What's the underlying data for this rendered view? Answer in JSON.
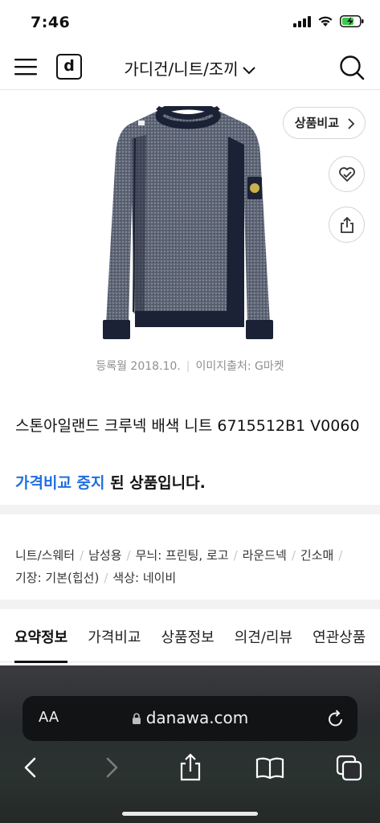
{
  "status_bar": {
    "time": "7:46"
  },
  "header": {
    "logo_letter": "d",
    "category": "가디건/니트/조끼"
  },
  "product": {
    "compare_label": "상품비교",
    "registered": "등록월 2018.10.",
    "image_source": "이미지출처: G마켓",
    "title": "스톤아일랜드 크루넥 배색 니트 6715512B1 V0060",
    "status_highlight": "가격비교 중지",
    "status_rest": " 된 상품입니다."
  },
  "specs": [
    "니트/스웨터",
    "남성용",
    "무늬: 프린팅, 로고",
    "라운드넥",
    "긴소매",
    "기장: 기본(힙선)",
    "색상: 네이비"
  ],
  "tabs": [
    {
      "label": "요약정보",
      "active": true
    },
    {
      "label": "가격비교",
      "active": false
    },
    {
      "label": "상품정보",
      "active": false
    },
    {
      "label": "의견/리뷰",
      "active": false
    },
    {
      "label": "연관상품",
      "active": false
    }
  ],
  "browser": {
    "aa_label": "AA",
    "domain": "danawa.com"
  },
  "colors": {
    "accent_blue": "#1f6fe0",
    "navy": "#1b2236"
  }
}
